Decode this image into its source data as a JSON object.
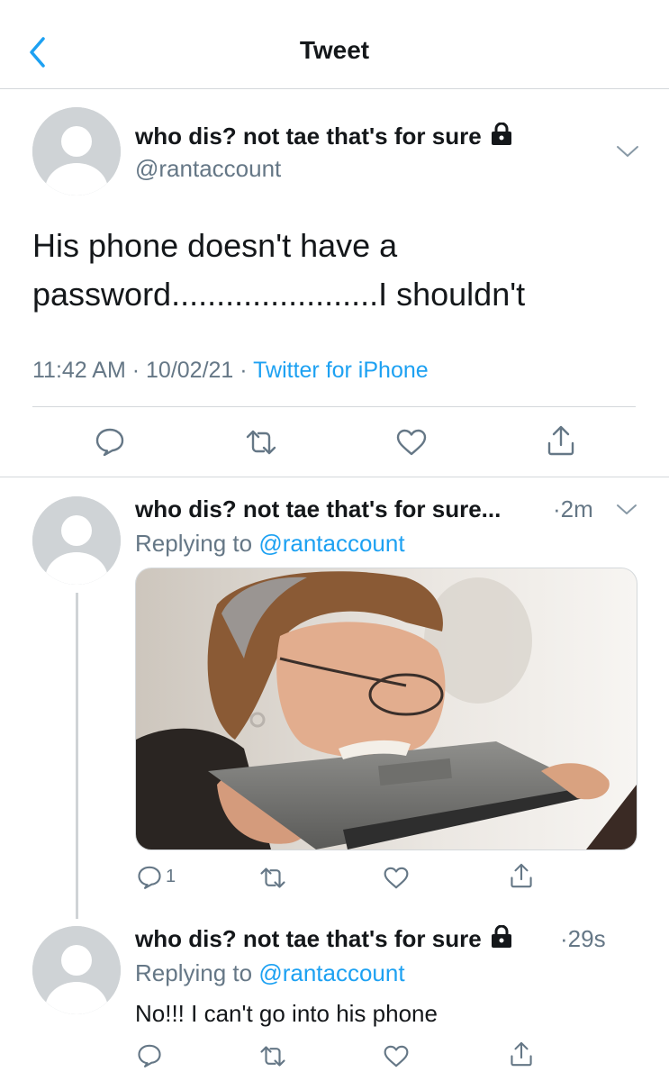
{
  "header": {
    "title": "Tweet"
  },
  "main_tweet": {
    "display_name": "who dis? not tae that's for sure",
    "handle": "@rantaccount",
    "text_line1": "His phone doesn't have a",
    "text_line2": "password.......................I shouldn't",
    "time": "11:42 AM",
    "date": "10/02/21",
    "source": "Twitter for iPhone"
  },
  "replies": [
    {
      "display_name": "who dis? not tae that's for sure...",
      "time": "2m",
      "replying_prefix": "Replying to",
      "replying_handle": "@rantaccount",
      "reply_count": "1"
    },
    {
      "display_name": "who dis? not tae that's for sure",
      "time": "29s",
      "replying_prefix": "Replying to",
      "replying_handle": "@rantaccount",
      "text": "No!!! I can't go into his phone"
    }
  ],
  "separators": {
    "dot": "·"
  },
  "colors": {
    "accent": "#1da1f2",
    "secondary_text": "#657786",
    "divider": "#d4d8db"
  },
  "icons": [
    "back-chevron-icon",
    "lock-icon",
    "chevron-down-icon",
    "reply-icon",
    "retweet-icon",
    "like-icon",
    "share-icon"
  ]
}
